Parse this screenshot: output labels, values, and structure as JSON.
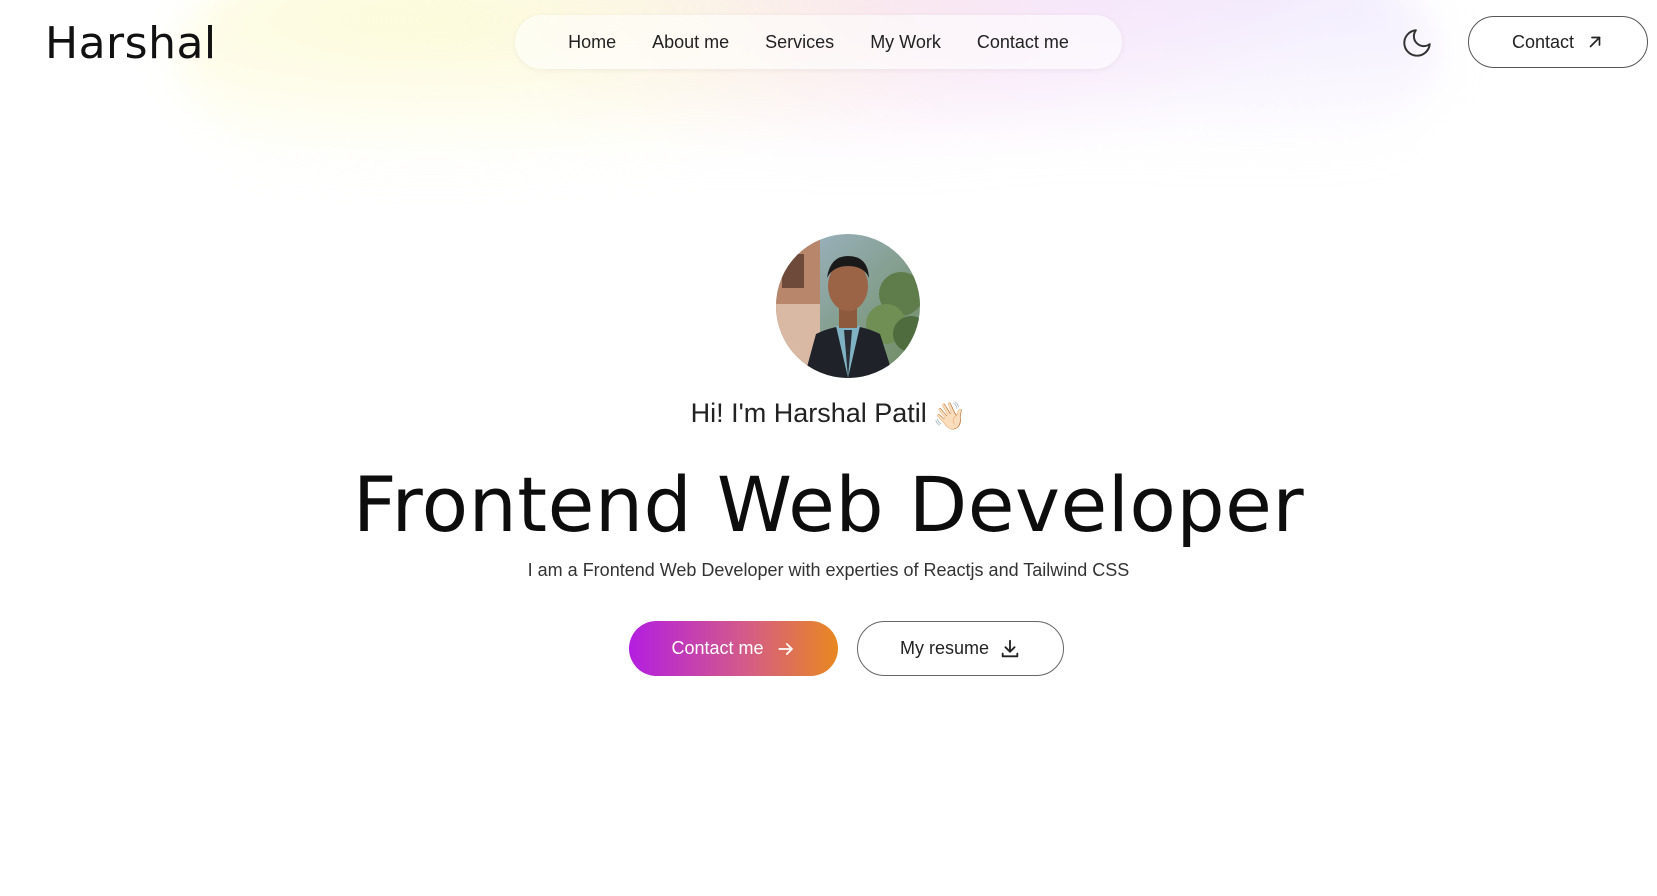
{
  "header": {
    "logo": "Harshal",
    "nav": [
      {
        "label": "Home"
      },
      {
        "label": "About me"
      },
      {
        "label": "Services"
      },
      {
        "label": "My Work"
      },
      {
        "label": "Contact me"
      }
    ],
    "theme_toggle_icon": "moon-icon",
    "contact_button": {
      "label": "Contact",
      "icon": "arrow-up-right-icon"
    }
  },
  "hero": {
    "avatar_alt": "profile photo",
    "greeting": "Hi! I'm Harshal Patil",
    "greeting_emoji": "👋🏻",
    "headline": "Frontend Web Developer",
    "description": "I am a Frontend Web Developer with experties of Reactjs and Tailwind CSS",
    "primary_button": {
      "label": "Contact me",
      "icon": "arrow-right-icon"
    },
    "secondary_button": {
      "label": "My resume",
      "icon": "download-icon"
    }
  },
  "colors": {
    "gradient_start": "#b31ee0",
    "gradient_end": "#e88820",
    "text": "#111111",
    "background": "#ffffff"
  }
}
